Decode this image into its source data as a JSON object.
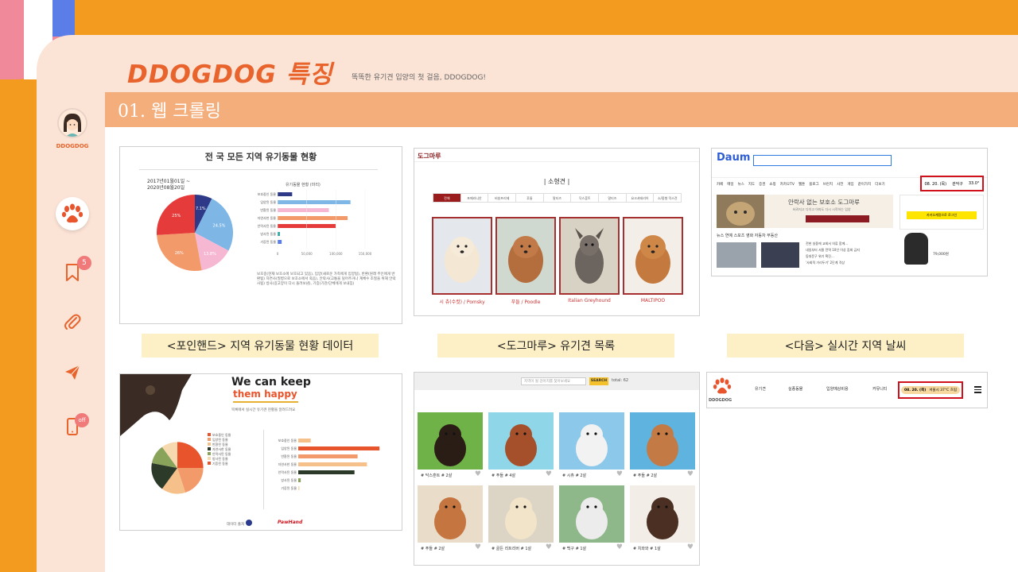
{
  "slide": {
    "title": "DDOGDOG 특징",
    "subtitle": "똑똑한 유기견 입양의 첫 걸음, DDOGDOG!",
    "section_label": "01. 웹 크롤링"
  },
  "sidebar": {
    "profile_label": "DDOGDOG",
    "bookmark_badge": "5",
    "phone_badge": "off"
  },
  "captions": [
    "<포인핸드> 지역 유기동물 현황 데이터",
    "<도그마루> 유기견 목록",
    "<다음> 실시간 지역 날씨"
  ],
  "shot1": {
    "title": "전 국 모든 지역 유기동물 현황",
    "date_range": "2017년01월01일 ~ 2020년08월20일",
    "bar_title": "유기동물 현황 (마리)",
    "pie_labels": [
      "7.1%",
      "24.5%",
      "13.8%",
      "26%",
      "25%"
    ],
    "categories": [
      "보호중인 동물",
      "입양된 동물",
      "반환된 동물",
      "자연사한 동물",
      "안락사된 동물",
      "방사된 동물",
      "기증된 동물"
    ],
    "ticks": [
      "0",
      "50,000",
      "100,000",
      "150,000"
    ],
    "note": "보호중(현재 보호소에 보호되고 있음), 입양(새로운 가족에게 입양됨), 반환(원래 주인에게 반환됨) 자연사(질병으로 보호소에서 죽음), 안락사(고통을 덜어주거나 계체수 조절을 위해 안락사됨) 방사(길고양이 다시 돌려보냄), 기증(기관/단체에게 보내짐)"
  },
  "chart_data": [
    {
      "type": "pie",
      "title": "전 국 모든 지역 유기동물 현황",
      "labels": [
        "7.1%",
        "24.5%",
        "13.8%",
        "26%",
        "25%"
      ],
      "values": [
        7.1,
        24.5,
        13.8,
        26,
        25
      ],
      "colors": [
        "#2e3a87",
        "#7eb6e6",
        "#f6b7d3",
        "#f39a6b",
        "#e53b3b"
      ]
    },
    {
      "type": "bar",
      "title": "유기동물 현황 (마리)",
      "categories": [
        "보호중인 동물",
        "입양된 동물",
        "반환된 동물",
        "자연사한 동물",
        "안락사된 동물",
        "방사된 동물",
        "기증된 동물"
      ],
      "values": [
        25000,
        125000,
        88000,
        120000,
        100000,
        4000,
        7000
      ],
      "colors": [
        "#2e3a87",
        "#7eb6e6",
        "#f6b7d3",
        "#f39a6b",
        "#e53b3b",
        "#2aa7a0",
        "#5b7de8"
      ],
      "xlim": [
        0,
        150000
      ]
    },
    {
      "type": "pie",
      "title": "We can keep them happy",
      "values": [
        25,
        20,
        15,
        18,
        12,
        10
      ],
      "colors": [
        "#e8542c",
        "#f39a6b",
        "#f6c08a",
        "#2c3a2a",
        "#8aa35a",
        "#f7d9b0"
      ]
    },
    {
      "type": "bar",
      "title": "We can keep them happy",
      "values": [
        20,
        130,
        95,
        110,
        90,
        4,
        2
      ],
      "colors": [
        "#f6c08a",
        "#e8542c",
        "#f39a6b",
        "#f6c08a",
        "#2c3a2a",
        "#8aa35a",
        "#f7d9b0"
      ],
      "xlim": [
        0,
        140
      ]
    }
  ],
  "shot2": {
    "logo": "도그마루",
    "heading": "| 소형견 |",
    "tabs": [
      "전체",
      "포메라니안",
      "비숑프리제",
      "푸들",
      "말티즈",
      "닥스훈트",
      "말티즈",
      "요크셔테리어",
      "소/중형 믹스견"
    ],
    "dogs": [
      "시 츄(수컷) / Pomsky",
      "푸들 / Poodle",
      "Italian Greyhound",
      "MALTIPOO"
    ]
  },
  "shot3": {
    "logo": "Daum",
    "date": "08. 20. (목)",
    "location": "관악구",
    "temp": "33.0°",
    "nav": [
      "카페",
      "메일",
      "뉴스",
      "지도",
      "증권",
      "쇼핑",
      "카카오TV",
      "웹툰",
      "블로그",
      "브런치",
      "사전",
      "게임",
      "같이가치",
      "더보기"
    ],
    "banner": "안락사 없는 보호소 도그마루",
    "banner_sub": "버려지고 다치고 아파도 다시 시작하는 입양",
    "login_btn": "카카오계정으로 로그인",
    "news_header": "뉴스  연예  스포츠  영화  자동차  부동산",
    "news_lines": [
      "전현 실중에 교회서 의류 함께...",
      "내일부터 서울 전역 10인 이상 집회 금지",
      "동대문구 위기 확진...",
      "'사회적 거리두기' 2단계 격상"
    ],
    "ad_price": "79,000원"
  },
  "shot4": {
    "title_line1": "We can keep",
    "title_line2": "them happy",
    "subtitle": "목록에서 실시간 유기견 현황을 알려드려요",
    "legend": [
      "보호중인 동물",
      "입양된 동물",
      "반환된 동물",
      "자연사한 동물",
      "안락사된 동물",
      "방사된 동물",
      "기증된 동물"
    ],
    "source": "데이터 출처",
    "source_brand": "PawHand"
  },
  "shot5": {
    "search_placeholder": "지역이 될 강아지를 찾아보세요",
    "search_btn": "SEARCH",
    "total": "total: 62",
    "labels": [
      "# 닥스훈트 # 2살",
      "# 푸들 # 4살",
      "# 시츄 # 2살",
      "# 푸들 # 2살",
      "# 푸들 # 2살",
      "# 골든 리트리버 # 1살",
      "# 백구 # 1살",
      "# 치와와 # 1살"
    ]
  },
  "shot6": {
    "brand": "DDOGDOG",
    "menu": [
      "유기견",
      "실종동물",
      "입양예상비용",
      "커뮤니티"
    ],
    "weather_date": "08. 20. (목)",
    "weather_text": "서울시 37°C 흐림"
  },
  "colors": {
    "accent": "#e8642c",
    "orange_bg": "#f29b1e",
    "panel": "#fbe3d6",
    "section_bar": "#f3ae7c",
    "caption_bg": "#fdf0c6",
    "highlight_red": "#d0111b"
  }
}
